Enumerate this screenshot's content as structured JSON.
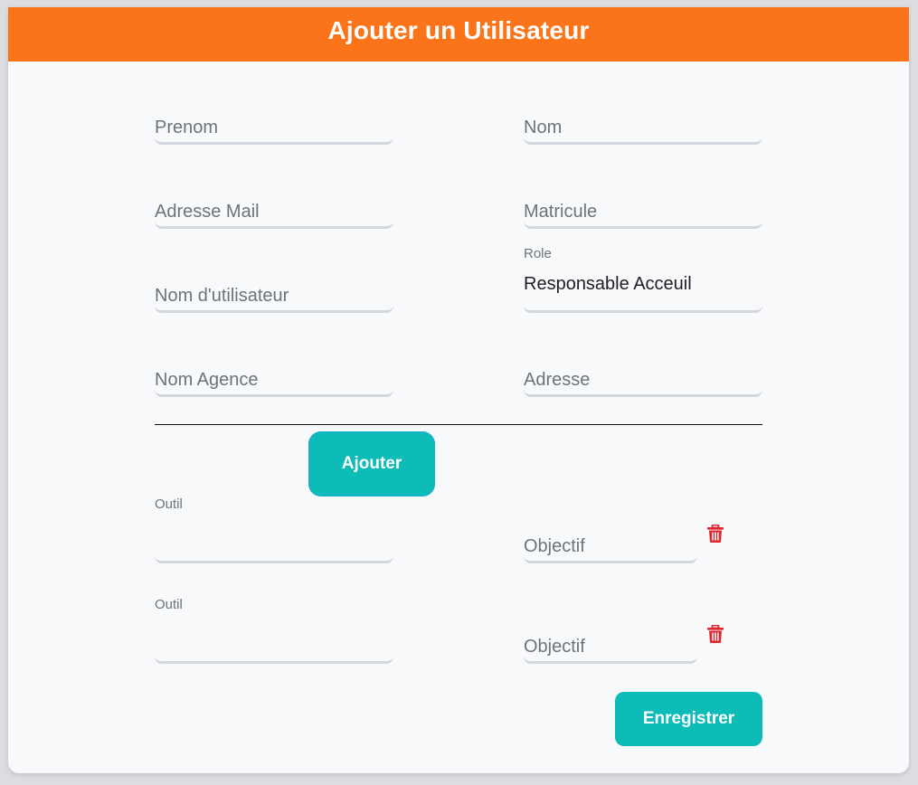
{
  "header": {
    "title": "Ajouter un Utilisateur"
  },
  "form": {
    "prenom": {
      "placeholder": "Prenom"
    },
    "nom": {
      "placeholder": "Nom"
    },
    "adresse_mail": {
      "placeholder": "Adresse Mail"
    },
    "matricule": {
      "placeholder": "Matricule"
    },
    "nom_utilisateur": {
      "placeholder": "Nom d'utilisateur"
    },
    "role": {
      "label": "Role",
      "value": "Responsable Acceuil"
    },
    "nom_agence": {
      "placeholder": "Nom Agence"
    },
    "adresse": {
      "placeholder": "Adresse"
    }
  },
  "outils": {
    "add_label": "Ajouter",
    "rows": [
      {
        "outil_label": "Outil",
        "objectif_placeholder": "Objectif",
        "delete_icon": "trash-icon"
      },
      {
        "outil_label": "Outil",
        "objectif_placeholder": "Objectif",
        "delete_icon": "trash-icon"
      }
    ]
  },
  "actions": {
    "save_label": "Enregistrer"
  },
  "colors": {
    "header_bg": "#fb7419",
    "button_bg": "#0dbbb7",
    "delete_icon": "#e0262f"
  }
}
